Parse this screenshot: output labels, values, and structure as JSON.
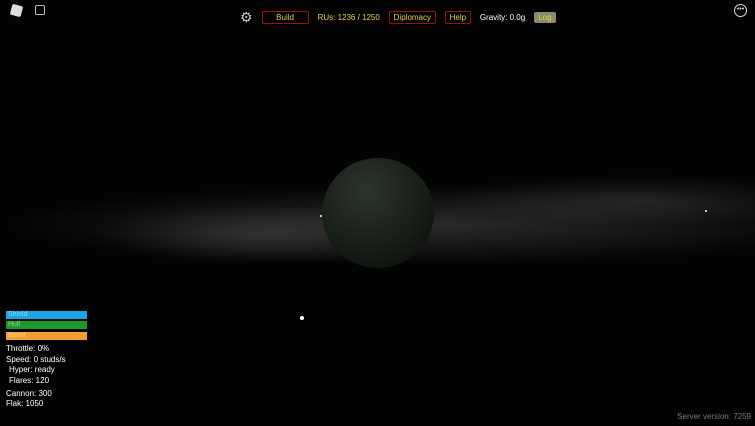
{
  "topbar": {
    "build": "Build",
    "rus": "RUs: 1236 / 1250",
    "diplomacy": "Diplomacy",
    "help": "Help",
    "gravity": "Gravity: 0.0g",
    "log": "Log"
  },
  "bars": {
    "shield": "Shield",
    "hull": "Hull",
    "boost": "Boost",
    "colors": {
      "shield": "#1aa6e6",
      "hull": "#1a9a2a",
      "boost": "#f0a030"
    }
  },
  "stats": {
    "throttle": "Throttle: 0%",
    "speed": "Speed: 0 studs/s",
    "hyper": "Hyper: ready",
    "flares": "Flares: 120",
    "cannon": "Cannon: 300",
    "flak": "Flak: 1050"
  },
  "server": "Server version: 7259"
}
